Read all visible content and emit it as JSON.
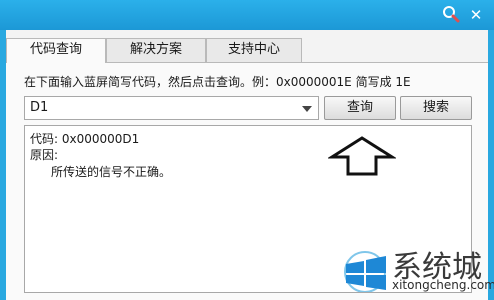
{
  "titlebar": {
    "search_icon": "search-icon",
    "close_icon": "close-icon"
  },
  "tabs": [
    {
      "label": "代码查询",
      "active": true
    },
    {
      "label": "解决方案",
      "active": false
    },
    {
      "label": "支持中心",
      "active": false
    }
  ],
  "panel": {
    "instruction": "在下面输入蓝屏简写代码，然后点击查询。例：0x0000001E 简写成 1E",
    "code_input_value": "D1",
    "query_button": "查询",
    "search_button": "搜索",
    "result": {
      "code_line": "代码: 0x000000D1",
      "reason_label": "原因:",
      "reason_text": "所传送的信号不正确。"
    }
  },
  "watermark": {
    "brand": "系统城",
    "url": "xitongcheng.com"
  },
  "colors": {
    "title_bar": "#29a8e0",
    "panel_bg": "#fafafa"
  }
}
